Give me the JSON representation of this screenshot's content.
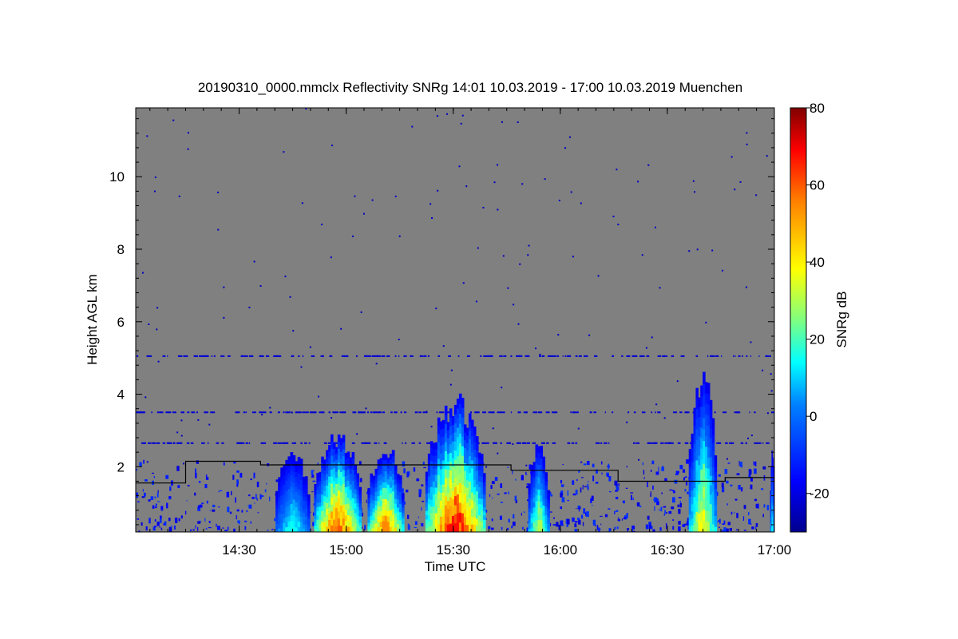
{
  "chart_data": {
    "type": "heatmap",
    "title": "20190310_0000.mmclx Reflectivity SNRg   14:01 10.03.2019 - 17:00 10.03.2019 Muenchen",
    "xlabel": "Time UTC",
    "ylabel": "Height AGL km",
    "colorbar_label": "SNRg dB",
    "x_range_hours": [
      14.017,
      17.0
    ],
    "y_range_km": [
      0.2,
      11.9
    ],
    "color_range_db": [
      -30,
      80
    ],
    "x_ticks": [
      {
        "label": "14:30",
        "value": 14.5
      },
      {
        "label": "15:00",
        "value": 15.0
      },
      {
        "label": "15:30",
        "value": 15.5
      },
      {
        "label": "16:00",
        "value": 16.0
      },
      {
        "label": "16:30",
        "value": 16.5
      },
      {
        "label": "17:00",
        "value": 17.0
      }
    ],
    "y_ticks": [
      {
        "label": "2",
        "value": 2
      },
      {
        "label": "4",
        "value": 4
      },
      {
        "label": "6",
        "value": 6
      },
      {
        "label": "8",
        "value": 8
      },
      {
        "label": "10",
        "value": 10
      }
    ],
    "colorbar_ticks": [
      {
        "label": "-20",
        "value": -20
      },
      {
        "label": "0",
        "value": 0
      },
      {
        "label": "20",
        "value": 20
      },
      {
        "label": "40",
        "value": 40
      },
      {
        "label": "60",
        "value": 60
      },
      {
        "label": "80",
        "value": 80
      }
    ],
    "background_color": "#808080",
    "echo_columns": [
      {
        "start": 14.67,
        "end": 14.83,
        "top_km": 2.6,
        "peak_db": 15
      },
      {
        "start": 14.85,
        "end": 15.07,
        "top_km": 3.1,
        "peak_db": 60
      },
      {
        "start": 15.1,
        "end": 15.27,
        "top_km": 2.7,
        "peak_db": 55
      },
      {
        "start": 15.37,
        "end": 15.65,
        "top_km": 4.1,
        "peak_db": 68
      },
      {
        "start": 15.85,
        "end": 15.95,
        "top_km": 2.7,
        "peak_db": 30
      },
      {
        "start": 16.6,
        "end": 16.73,
        "top_km": 4.8,
        "peak_db": 38
      },
      {
        "start": 16.98,
        "end": 17.0,
        "top_km": 2.5,
        "peak_db": 15
      }
    ],
    "noise_layers_km": [
      5.05,
      3.5,
      2.65
    ],
    "boundary_line_km": [
      {
        "x": 14.017,
        "y": 1.55
      },
      {
        "x": 14.25,
        "y": 1.55
      },
      {
        "x": 14.25,
        "y": 2.15
      },
      {
        "x": 14.6,
        "y": 2.15
      },
      {
        "x": 14.6,
        "y": 2.05
      },
      {
        "x": 15.77,
        "y": 2.05
      },
      {
        "x": 15.77,
        "y": 1.9
      },
      {
        "x": 16.27,
        "y": 1.9
      },
      {
        "x": 16.27,
        "y": 1.6
      },
      {
        "x": 16.77,
        "y": 1.6
      },
      {
        "x": 16.77,
        "y": 1.7
      },
      {
        "x": 17.0,
        "y": 1.7
      }
    ],
    "grid": false,
    "legend": "none"
  }
}
